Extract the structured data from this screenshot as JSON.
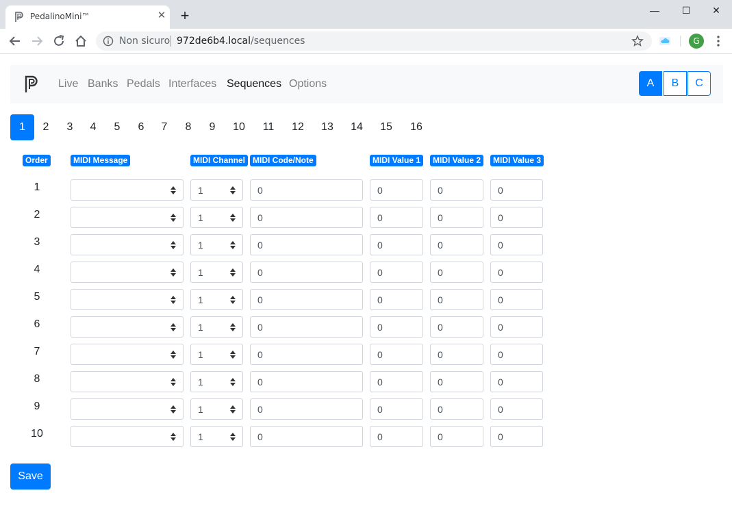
{
  "browser": {
    "tab_title": "PedalinoMini™",
    "not_secure": "Non sicuro",
    "url_host": "972de6b4.local",
    "url_path": "/sequences",
    "avatar_initial": "G"
  },
  "navbar": {
    "links": [
      "Live",
      "Banks",
      "Pedals",
      "Interfaces",
      "Sequences",
      "Options"
    ],
    "active_link": "Sequences",
    "profiles": [
      "A",
      "B",
      "C"
    ],
    "active_profile": "A"
  },
  "sequence_tabs": [
    "1",
    "2",
    "3",
    "4",
    "5",
    "6",
    "7",
    "8",
    "9",
    "10",
    "11",
    "12",
    "13",
    "14",
    "15",
    "16"
  ],
  "active_sequence": "1",
  "table": {
    "headers": {
      "order": "Order",
      "midi_message": "MIDI Message",
      "midi_channel": "MIDI Channel",
      "midi_code": "MIDI Code/Note",
      "midi_value1": "MIDI Value 1",
      "midi_value2": "MIDI Value 2",
      "midi_value3": "MIDI Value 3"
    },
    "rows": [
      {
        "order": "1",
        "message": "",
        "channel": "1",
        "code": "0",
        "value1": "0",
        "value2": "0",
        "value3": "0"
      },
      {
        "order": "2",
        "message": "",
        "channel": "1",
        "code": "0",
        "value1": "0",
        "value2": "0",
        "value3": "0"
      },
      {
        "order": "3",
        "message": "",
        "channel": "1",
        "code": "0",
        "value1": "0",
        "value2": "0",
        "value3": "0"
      },
      {
        "order": "4",
        "message": "",
        "channel": "1",
        "code": "0",
        "value1": "0",
        "value2": "0",
        "value3": "0"
      },
      {
        "order": "5",
        "message": "",
        "channel": "1",
        "code": "0",
        "value1": "0",
        "value2": "0",
        "value3": "0"
      },
      {
        "order": "6",
        "message": "",
        "channel": "1",
        "code": "0",
        "value1": "0",
        "value2": "0",
        "value3": "0"
      },
      {
        "order": "7",
        "message": "",
        "channel": "1",
        "code": "0",
        "value1": "0",
        "value2": "0",
        "value3": "0"
      },
      {
        "order": "8",
        "message": "",
        "channel": "1",
        "code": "0",
        "value1": "0",
        "value2": "0",
        "value3": "0"
      },
      {
        "order": "9",
        "message": "",
        "channel": "1",
        "code": "0",
        "value1": "0",
        "value2": "0",
        "value3": "0"
      },
      {
        "order": "10",
        "message": "",
        "channel": "1",
        "code": "0",
        "value1": "0",
        "value2": "0",
        "value3": "0"
      }
    ]
  },
  "save_label": "Save",
  "colors": {
    "primary": "#007bff",
    "navbar_bg": "#f8f9fa"
  }
}
